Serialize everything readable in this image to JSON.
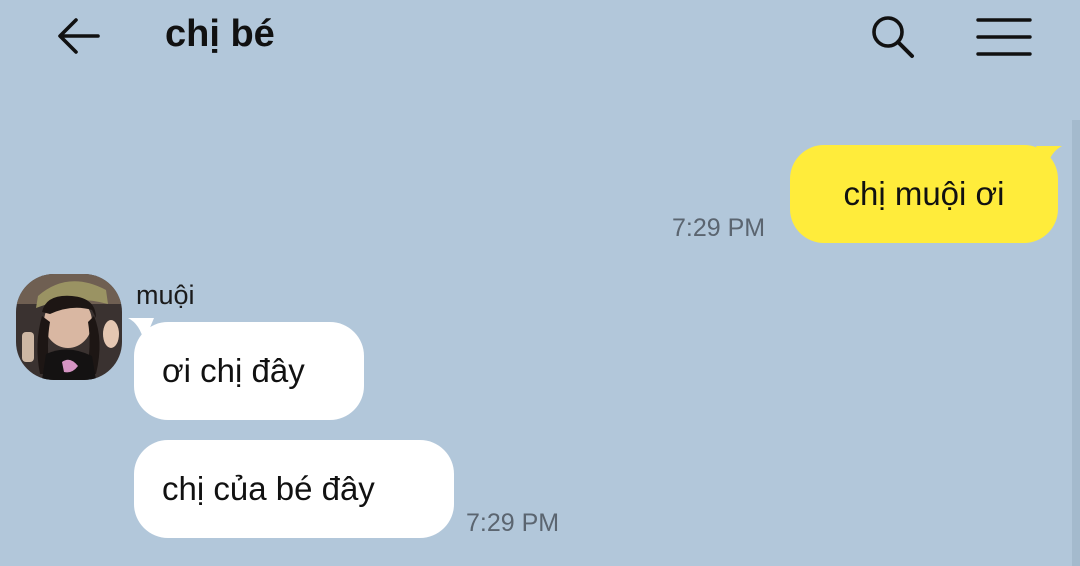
{
  "header": {
    "title": "chị bé",
    "back_icon": "arrow-left-icon",
    "search_icon": "search-icon",
    "menu_icon": "hamburger-menu-icon"
  },
  "messages": [
    {
      "direction": "outgoing",
      "text": "chị muội ơi",
      "time": "7:29 PM"
    },
    {
      "direction": "incoming",
      "sender": "muội",
      "text": "ơi chị đây"
    },
    {
      "direction": "incoming",
      "sender": "muội",
      "text": "chị của bé đây",
      "time": "7:29 PM"
    }
  ],
  "colors": {
    "background": "#b2c7da",
    "outgoing_bubble": "#ffec3b",
    "incoming_bubble": "#ffffff",
    "timestamp": "#5b6570"
  }
}
